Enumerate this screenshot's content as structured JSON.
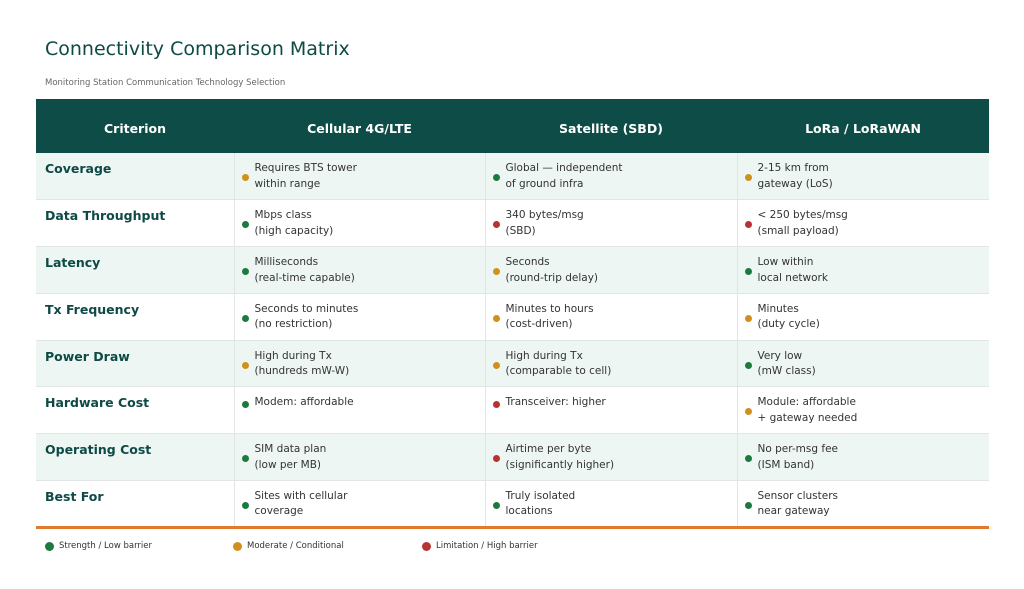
{
  "title": "Connectivity Comparison Matrix",
  "subtitle": "Monitoring Station Communication Technology Selection",
  "colors": {
    "header_bg": "#0e4c47",
    "strength": "#1c7a3e",
    "moderate": "#d1901c",
    "limitation": "#b73232",
    "accent_line": "#e07a2e"
  },
  "headers": [
    "Criterion",
    "Cellular 4G/LTE",
    "Satellite (SBD)",
    "LoRa / LoRaWAN"
  ],
  "rows": [
    {
      "criterion": "Coverage",
      "cells": [
        {
          "rating": "amber",
          "lines": [
            "Requires BTS tower",
            "within range"
          ]
        },
        {
          "rating": "green",
          "lines": [
            "Global — independent",
            "of ground infra"
          ]
        },
        {
          "rating": "amber",
          "lines": [
            "2-15 km from",
            "gateway (LoS)"
          ]
        }
      ]
    },
    {
      "criterion": "Data Throughput",
      "cells": [
        {
          "rating": "green",
          "lines": [
            "Mbps class",
            "(high capacity)"
          ]
        },
        {
          "rating": "red",
          "lines": [
            "340 bytes/msg",
            "(SBD)"
          ]
        },
        {
          "rating": "red",
          "lines": [
            "< 250 bytes/msg",
            "(small payload)"
          ]
        }
      ]
    },
    {
      "criterion": "Latency",
      "cells": [
        {
          "rating": "green",
          "lines": [
            "Milliseconds",
            "(real-time capable)"
          ]
        },
        {
          "rating": "amber",
          "lines": [
            "Seconds",
            "(round-trip delay)"
          ]
        },
        {
          "rating": "green",
          "lines": [
            "Low within",
            "local network"
          ]
        }
      ]
    },
    {
      "criterion": "Tx Frequency",
      "cells": [
        {
          "rating": "green",
          "lines": [
            "Seconds to minutes",
            "(no restriction)"
          ]
        },
        {
          "rating": "amber",
          "lines": [
            "Minutes to hours",
            "(cost-driven)"
          ]
        },
        {
          "rating": "amber",
          "lines": [
            "Minutes",
            "(duty cycle)"
          ]
        }
      ]
    },
    {
      "criterion": "Power Draw",
      "cells": [
        {
          "rating": "amber",
          "lines": [
            "High during Tx",
            "(hundreds mW-W)"
          ]
        },
        {
          "rating": "amber",
          "lines": [
            "High during Tx",
            "(comparable to cell)"
          ]
        },
        {
          "rating": "green",
          "lines": [
            "Very low",
            "(mW class)"
          ]
        }
      ]
    },
    {
      "criterion": "Hardware Cost",
      "cells": [
        {
          "rating": "green",
          "lines": [
            "Modem: affordable"
          ]
        },
        {
          "rating": "red",
          "lines": [
            "Transceiver: higher"
          ]
        },
        {
          "rating": "amber",
          "lines": [
            "Module: affordable",
            "+ gateway needed"
          ]
        }
      ]
    },
    {
      "criterion": "Operating Cost",
      "cells": [
        {
          "rating": "green",
          "lines": [
            "SIM data plan",
            "(low per MB)"
          ]
        },
        {
          "rating": "red",
          "lines": [
            "Airtime per byte",
            "(significantly higher)"
          ]
        },
        {
          "rating": "green",
          "lines": [
            "No per-msg fee",
            "(ISM band)"
          ]
        }
      ]
    },
    {
      "criterion": "Best For",
      "cells": [
        {
          "rating": "green",
          "lines": [
            "Sites with cellular",
            "coverage"
          ]
        },
        {
          "rating": "green",
          "lines": [
            "Truly isolated",
            "locations"
          ]
        },
        {
          "rating": "green",
          "lines": [
            "Sensor clusters",
            "near gateway"
          ]
        }
      ]
    }
  ],
  "legend": [
    {
      "rating": "green",
      "label": "Strength / Low barrier"
    },
    {
      "rating": "amber",
      "label": "Moderate / Conditional"
    },
    {
      "rating": "red",
      "label": "Limitation / High barrier"
    }
  ]
}
